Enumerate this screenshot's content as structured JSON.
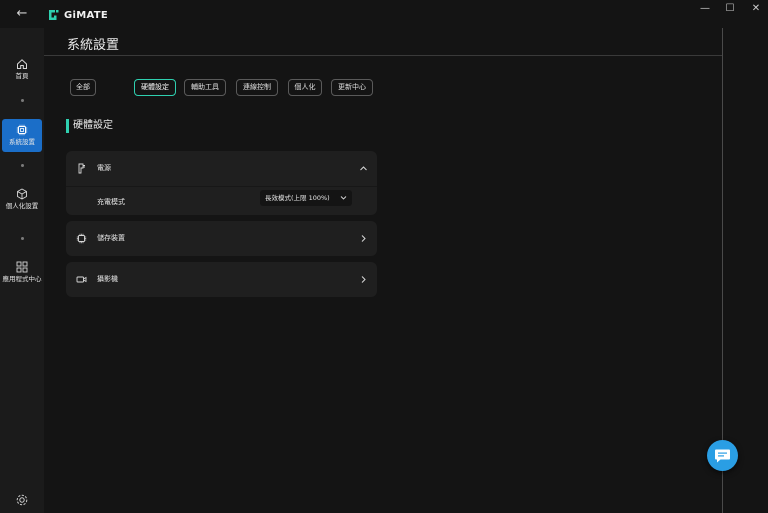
{
  "app": {
    "name": "GiMATE"
  },
  "window": {
    "minimize": "—",
    "maximize": "☐",
    "close": "✕",
    "back": "←"
  },
  "sidebar": {
    "items": [
      {
        "label": "首頁",
        "icon": "home-icon"
      },
      {
        "label": "系統設置",
        "icon": "system-settings-icon",
        "active": true
      },
      {
        "label": "個人化設置",
        "icon": "cube-icon"
      },
      {
        "label": "應用程式中心",
        "icon": "app-grid-icon"
      }
    ],
    "bottom_icon": "gear-icon"
  },
  "page": {
    "title": "系統設置"
  },
  "tabs": [
    {
      "label": "全部"
    },
    {
      "label": "硬體設定",
      "active": true
    },
    {
      "label": "輔助工具"
    },
    {
      "label": "連線控制"
    },
    {
      "label": "個人化"
    },
    {
      "label": "更新中心"
    }
  ],
  "section": {
    "title": "硬體設定"
  },
  "cards": {
    "power": {
      "label": "電源",
      "icon": "power-plug-icon",
      "expanded": true,
      "row": {
        "label": "充電模式",
        "value": "長效模式(上限 100%)"
      }
    },
    "storage": {
      "label": "儲存裝置",
      "icon": "chip-icon"
    },
    "camera": {
      "label": "攝影機",
      "icon": "camera-icon"
    }
  },
  "colors": {
    "accent": "#2fd0b0",
    "active_nav": "#1b6ec8",
    "fab": "#2a9ee4"
  },
  "fab": {
    "icon": "chat-icon"
  }
}
